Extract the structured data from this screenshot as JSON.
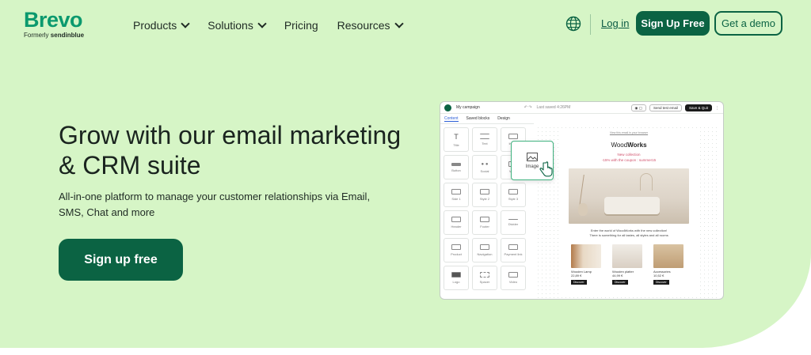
{
  "brand": {
    "name": "Brevo",
    "formerly_prefix": "Formerly",
    "formerly_name": "sendinblue",
    "accent": "#0b996e",
    "dark_green": "#0b6343",
    "hero_bg": "#d6f5c6"
  },
  "nav": {
    "items": [
      {
        "label": "Products",
        "has_dropdown": true
      },
      {
        "label": "Solutions",
        "has_dropdown": true
      },
      {
        "label": "Pricing",
        "has_dropdown": false
      },
      {
        "label": "Resources",
        "has_dropdown": true
      }
    ],
    "globe_icon": "globe-icon",
    "login": "Log in",
    "signup": "Sign Up Free",
    "demo": "Get a demo"
  },
  "hero": {
    "headline": "Grow with our email marketing & CRM suite",
    "subtext": "All-in-one platform to manage your customer relationships via Email, SMS, Chat and more",
    "cta": "Sign up free"
  },
  "editor": {
    "campaign": "My campaign",
    "saved": "Last saved 4:26PM",
    "send_test": "Send test email",
    "save_quit": "Save & Quit",
    "tabs": [
      "Content",
      "Saved blocks",
      "Design"
    ],
    "blocks": [
      "Title",
      "Text",
      "Image",
      "Button",
      "Social",
      "Video",
      "Side 1",
      "Style 2",
      "Style 3",
      "Header",
      "Footer",
      "Divider",
      "Product",
      "Navigation",
      "Payment link",
      "Logo",
      "Spacer",
      "Video"
    ],
    "email": {
      "view_link": "View this email in your browser",
      "brand_a": "Wood",
      "brand_b": "Works",
      "promo_line1": "New collection",
      "promo_line2": "-15% with the coupon : summer15",
      "intro_line1": "Enter the world of WoodWorks with the new collection!",
      "intro_line2": "There is something for all tastes, all styles and all rooms",
      "products": [
        {
          "name": "Wooden Lamp",
          "price": "22,89 €",
          "button": "Discover"
        },
        {
          "name": "Wooden platter",
          "price": "44,99 €",
          "button": "Discover"
        },
        {
          "name": "Accessories",
          "price": "10,52 €",
          "button": "Discover"
        }
      ]
    },
    "drag_card": "Image"
  }
}
